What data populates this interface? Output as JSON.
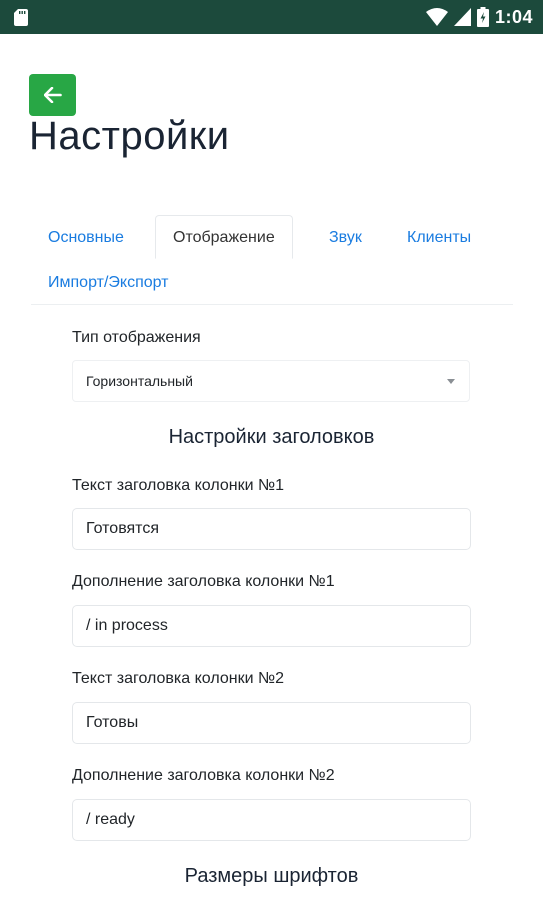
{
  "status_bar": {
    "time": "1:04",
    "icons": [
      "sd-card-icon",
      "wifi-icon",
      "signal-icon",
      "battery-icon"
    ]
  },
  "header": {
    "back_icon": "arrow-left-icon",
    "title": "Настройки"
  },
  "tabs": [
    {
      "label": "Основные",
      "active": false
    },
    {
      "label": "Отображение",
      "active": true
    },
    {
      "label": "Звук",
      "active": false
    },
    {
      "label": "Клиенты",
      "active": false
    },
    {
      "label": "Импорт/Экспорт",
      "active": false
    }
  ],
  "form": {
    "display_type": {
      "label": "Тип отображения",
      "value": "Горизонтальный"
    },
    "headers_section_title": "Настройки заголовков",
    "col1_text": {
      "label": "Текст заголовка колонки №1",
      "value": "Готовятся"
    },
    "col1_addition": {
      "label": "Дополнение заголовка колонки №1",
      "value": "/ in process"
    },
    "col2_text": {
      "label": "Текст заголовка колонки №2",
      "value": "Готовы"
    },
    "col2_addition": {
      "label": "Дополнение заголовка колонки №2",
      "value": "/ ready"
    },
    "fonts_section_title": "Размеры шрифтов"
  },
  "colors": {
    "status_bar": "#1c4a3c",
    "accent_green": "#28a745",
    "tab_link": "#1a7ce0"
  }
}
